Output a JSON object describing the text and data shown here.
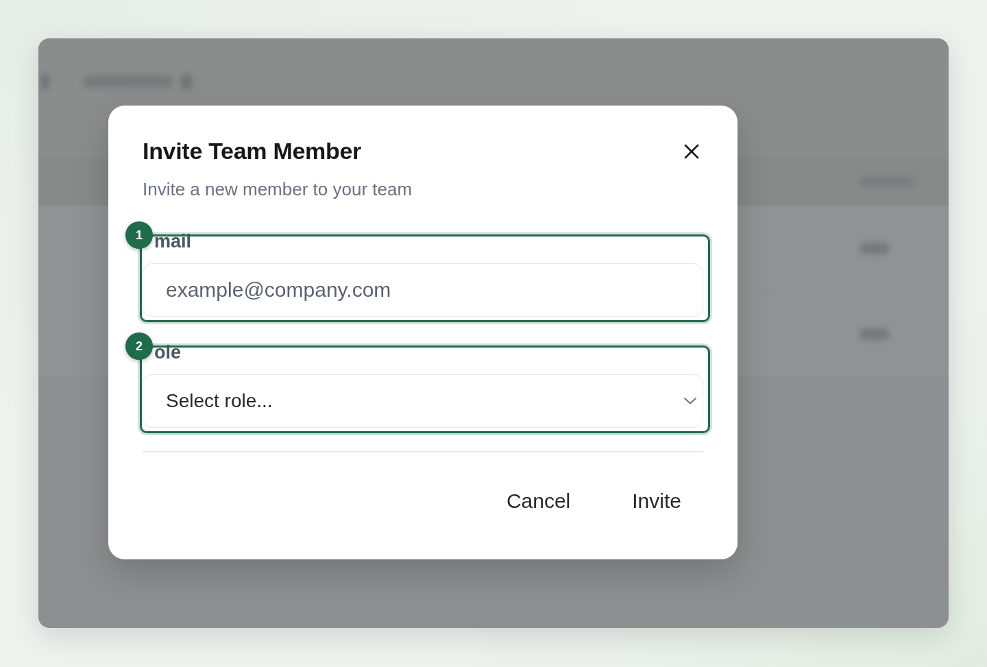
{
  "dialog": {
    "title": "Invite Team Member",
    "subtitle": "Invite a new member to your team",
    "fields": [
      {
        "kind": "text",
        "label": "mail",
        "placeholder": "example@company.com",
        "highlight": {
          "badge": "1"
        }
      },
      {
        "kind": "select",
        "label": "ole",
        "value": "Select role...",
        "highlight": {
          "badge": "2"
        }
      }
    ],
    "buttons": [
      {
        "label": "Cancel"
      },
      {
        "label": "Invite"
      }
    ]
  }
}
